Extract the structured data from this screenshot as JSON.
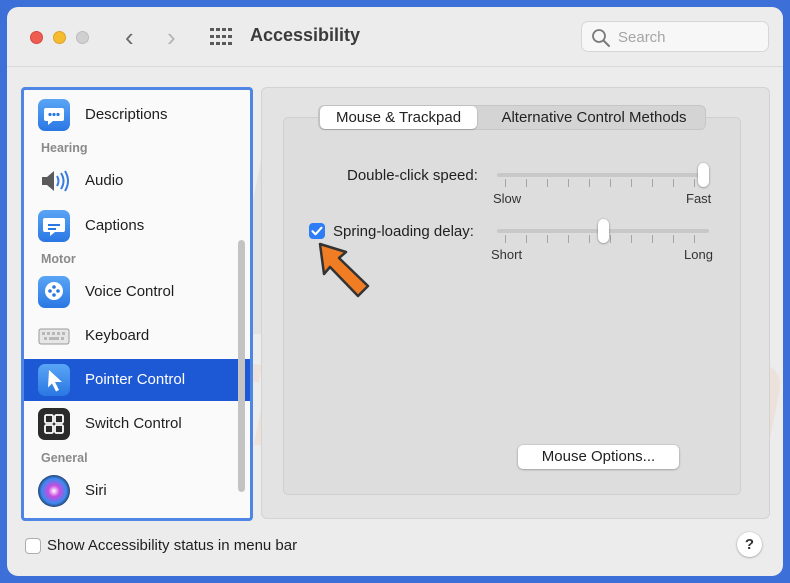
{
  "window": {
    "title": "Accessibility",
    "search_placeholder": "Search"
  },
  "sidebar": {
    "items": [
      {
        "label": "Descriptions",
        "icon": "descriptions-icon"
      },
      {
        "section": "Hearing"
      },
      {
        "label": "Audio",
        "icon": "speaker-icon"
      },
      {
        "label": "Captions",
        "icon": "captions-icon"
      },
      {
        "section": "Motor"
      },
      {
        "label": "Voice Control",
        "icon": "voice-control-icon"
      },
      {
        "label": "Keyboard",
        "icon": "keyboard-icon"
      },
      {
        "label": "Pointer Control",
        "icon": "pointer-icon",
        "selected": true
      },
      {
        "label": "Switch Control",
        "icon": "switch-control-icon"
      },
      {
        "section": "General"
      },
      {
        "label": "Siri",
        "icon": "siri-icon"
      }
    ]
  },
  "tabs": {
    "active": "Mouse & Trackpad",
    "other": "Alternative Control Methods"
  },
  "double_click": {
    "label": "Double-click speed:",
    "min_label": "Slow",
    "max_label": "Fast",
    "value": 1.0
  },
  "spring_loading": {
    "label": "Spring-loading delay:",
    "checked": true,
    "min_label": "Short",
    "max_label": "Long",
    "value": 0.5
  },
  "mouse_options_button": "Mouse Options...",
  "footer": {
    "status_checkbox_label": "Show Accessibility status in menu bar",
    "status_checked": false,
    "help_label": "?"
  },
  "watermark": {
    "line1": "PC",
    "line2": "risk.com"
  },
  "colors": {
    "accent": "#1d58d5",
    "checkbox": "#2e7cf6",
    "arrow": "#f07d24",
    "background": "#3c6fd8"
  }
}
